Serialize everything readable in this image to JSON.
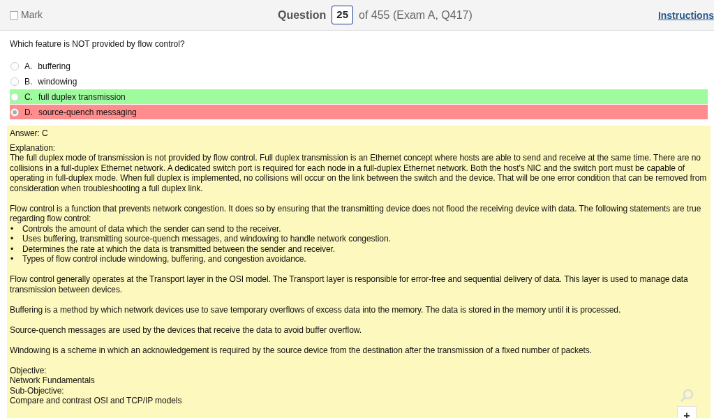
{
  "header": {
    "mark": {
      "label": "Mark",
      "checked": false
    },
    "question_label": "Question",
    "question_number": "25",
    "question_total": "of 455 (Exam A, Q417)",
    "instructions": "Instructions"
  },
  "question": "Which feature is NOT provided by flow control?",
  "options": [
    {
      "letter": "A.",
      "text": "buffering",
      "selected": false,
      "correct": false,
      "wrong": false
    },
    {
      "letter": "B.",
      "text": "windowing",
      "selected": false,
      "correct": false,
      "wrong": false
    },
    {
      "letter": "C.",
      "text": "full duplex transmission",
      "selected": false,
      "correct": true,
      "wrong": false
    },
    {
      "letter": "D.",
      "text": "source-quench messaging",
      "selected": true,
      "correct": false,
      "wrong": true
    }
  ],
  "answer": "Answer: C",
  "explanation_label": "Explanation:",
  "blocks": [
    {
      "kind": "paragraph",
      "text": "The full duplex mode of transmission is not provided by flow control. Full duplex transmission is an Ethernet concept where hosts are able to send and receive at the same time. There are no collisions in a full-duplex Ethernet network. A dedicated switch port is required for each node in a full-duplex Ethernet network. Both the host's NIC and the switch port must be capable of operating in full-duplex mode. When full duplex is implemented, no collisions will occur on the link between the switch and the device. That will be one error condition that can be removed from consideration when troubleshooting a full duplex link."
    },
    {
      "kind": "paragraph",
      "text": "Flow control is a function that prevents network congestion. It does so by ensuring that the transmitting device does not flood the receiving device with data. The following statements are true regarding flow control:",
      "tight": true
    },
    {
      "kind": "bullets",
      "items": [
        {
          "bullet": "•",
          "text": "Controls the amount of data which the sender can send to the receiver."
        },
        {
          "bullet": "•",
          "text": "Uses buffering, transmitting source-quench messages, and windowing to handle network congestion."
        },
        {
          "bullet": "•",
          "text": "Determines the rate at which the data is transmitted between the sender and receiver."
        },
        {
          "bullet": "•",
          "text": "Types of flow control include windowing, buffering, and congestion avoidance."
        }
      ]
    },
    {
      "kind": "paragraph",
      "text": "Flow control generally operates at the Transport layer in the OSI model. The Transport layer is responsible for error-free and sequential delivery of data. This layer is used to manage data transmission between devices."
    },
    {
      "kind": "paragraph",
      "text": "Buffering is a method by which network devices use to save temporary overflows of excess data into the memory. The data is stored in the memory until it is processed."
    },
    {
      "kind": "paragraph",
      "text": "Source-quench messages are used by the devices that receive the data to avoid buffer overflow."
    },
    {
      "kind": "paragraph",
      "text": "Windowing is a scheme in which an acknowledgement is required by the source device from the destination after the transmission of a fixed number of packets."
    },
    {
      "kind": "lines",
      "items": [
        "Objective:",
        "Network Fundamentals",
        "Sub-Objective:",
        "Compare and contrast OSI and TCP/IP models"
      ]
    }
  ],
  "zoom": {
    "plus": "+"
  }
}
